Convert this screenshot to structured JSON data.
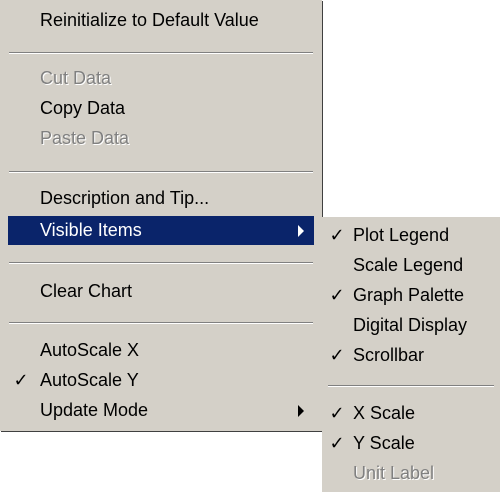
{
  "context_menu": {
    "items": [
      {
        "label": "Reinitialize to Default Value"
      },
      {
        "label": "Cut Data",
        "disabled": true
      },
      {
        "label": "Copy Data"
      },
      {
        "label": "Paste Data",
        "disabled": true
      },
      {
        "label": "Description and Tip..."
      },
      {
        "label": "Visible Items",
        "highlighted": true,
        "submenu": true
      },
      {
        "label": "Clear Chart"
      },
      {
        "label": "AutoScale X"
      },
      {
        "label": "AutoScale Y",
        "check": "✓"
      },
      {
        "label": "Update Mode",
        "submenu": true
      }
    ]
  },
  "visible_items_submenu": {
    "items": [
      {
        "label": "Plot Legend",
        "check": "✓"
      },
      {
        "label": "Scale Legend"
      },
      {
        "label": "Graph Palette",
        "check": "✓"
      },
      {
        "label": "Digital Display"
      },
      {
        "label": "Scrollbar",
        "check": "✓"
      },
      {
        "label": "X Scale",
        "check": "✓"
      },
      {
        "label": "Y Scale",
        "check": "✓"
      },
      {
        "label": "Unit Label",
        "disabled": true
      }
    ]
  },
  "colors": {
    "menu_background": "#d4d0c8",
    "highlight": "#0a246a",
    "disabled_text": "#808080"
  }
}
